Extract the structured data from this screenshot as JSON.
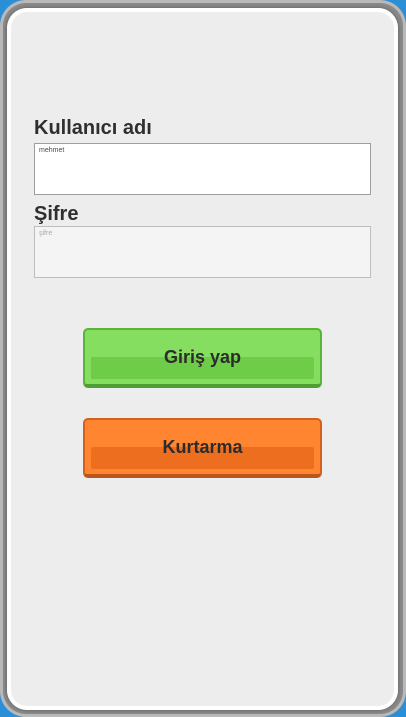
{
  "form": {
    "username_label": "Kullanıcı adı",
    "username_value": "mehmet",
    "password_label": "Şifre",
    "password_placeholder": "şifre"
  },
  "buttons": {
    "login_label": "Giriş yap",
    "recover_label": "Kurtarma"
  },
  "colors": {
    "login_button": "#86de60",
    "recover_button": "#ff8530",
    "panel_background": "#ededed"
  }
}
